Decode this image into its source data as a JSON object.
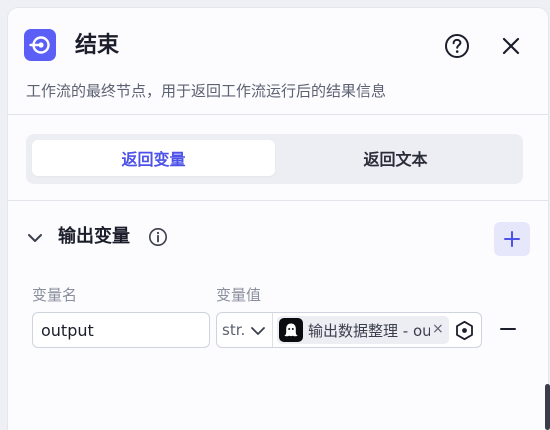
{
  "header": {
    "title": "结束",
    "description": "工作流的最终节点，用于返回工作流运行后的结果信息",
    "icons": {
      "node": "end-node-icon",
      "help": "help-icon",
      "close": "close-icon"
    }
  },
  "mode_tabs": [
    {
      "label": "返回变量",
      "active": true
    },
    {
      "label": "返回文本",
      "active": false
    }
  ],
  "output_section": {
    "title": "输出变量",
    "columns": {
      "name": "变量名",
      "value": "变量值"
    },
    "rows": [
      {
        "name": "output",
        "type": "str.",
        "reference": "输出数据整理 - output",
        "reference_remove": "×"
      }
    ]
  },
  "colors": {
    "accent": "#4d53e8",
    "node_icon_bg": "#5b5ff5",
    "add_button_bg": "#e6e7fb"
  }
}
